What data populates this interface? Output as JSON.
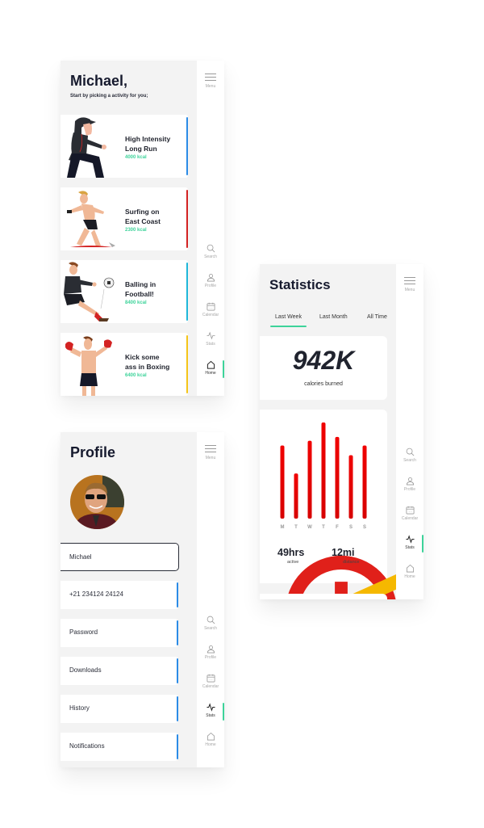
{
  "colors": {
    "accent_green": "#3dd39a",
    "bar_red": "#e30613",
    "blue": "#2b8be6",
    "red": "#d32222",
    "cyan": "#1fb7d9",
    "yellow": "#f5c518",
    "panel_bg": "#f3f3f3"
  },
  "sidebar": {
    "menu_label": "Menu",
    "items": [
      {
        "label": "Search",
        "icon": "search-icon"
      },
      {
        "label": "Profile",
        "icon": "user-icon"
      },
      {
        "label": "Calendar",
        "icon": "calendar-icon"
      },
      {
        "label": "Stats",
        "icon": "activity-icon"
      },
      {
        "label": "Home",
        "icon": "home-icon"
      }
    ]
  },
  "home": {
    "greeting": "Michael,",
    "subtitle": "Start by picking a activity for you;",
    "active_nav": "Home",
    "activities": [
      {
        "title_line1": "High Intensity",
        "title_line2": "Long Run",
        "kcal": "4000 kcal",
        "accent": "#2b8be6",
        "illustration": "runner"
      },
      {
        "title_line1": "Surfing on",
        "title_line2": "East Coast",
        "kcal": "2300 kcal",
        "accent": "#d32222",
        "illustration": "surfer"
      },
      {
        "title_line1": "Balling in",
        "title_line2": "Football!",
        "kcal": "8400 kcal",
        "accent": "#1fb7d9",
        "illustration": "footballer"
      },
      {
        "title_line1": "Kick some",
        "title_line2": "ass in Boxing",
        "kcal": "6400 kcal",
        "accent": "#f5c518",
        "illustration": "boxer"
      }
    ]
  },
  "stats": {
    "title": "Statistics",
    "active_nav": "Stats",
    "tabs": [
      {
        "label": "Last Week",
        "active": true
      },
      {
        "label": "Last Month",
        "active": false
      },
      {
        "label": "All Time",
        "active": false
      }
    ],
    "calories_value": "942K",
    "calories_label": "calories burned",
    "active_value": "49hrs",
    "active_label": "active",
    "distance_value": "12mi",
    "distance_label": "distance"
  },
  "chart_data": {
    "type": "bar",
    "title": "",
    "xlabel": "",
    "ylabel": "",
    "categories": [
      "M",
      "T",
      "W",
      "T",
      "F",
      "S",
      "S"
    ],
    "values": [
      76,
      47,
      81,
      100,
      85,
      66,
      76
    ],
    "ylim": [
      0,
      100
    ],
    "grid": false,
    "legend": "none"
  },
  "profile": {
    "title": "Profile",
    "active_nav": "Stats",
    "fields": [
      {
        "value": "Michael",
        "focused": true
      },
      {
        "value": "+21 234124 24124",
        "focused": false
      },
      {
        "value": "Password",
        "focused": false
      },
      {
        "value": "Downloads",
        "focused": false
      },
      {
        "value": "History",
        "focused": false
      },
      {
        "value": "Notifications",
        "focused": false
      }
    ]
  }
}
